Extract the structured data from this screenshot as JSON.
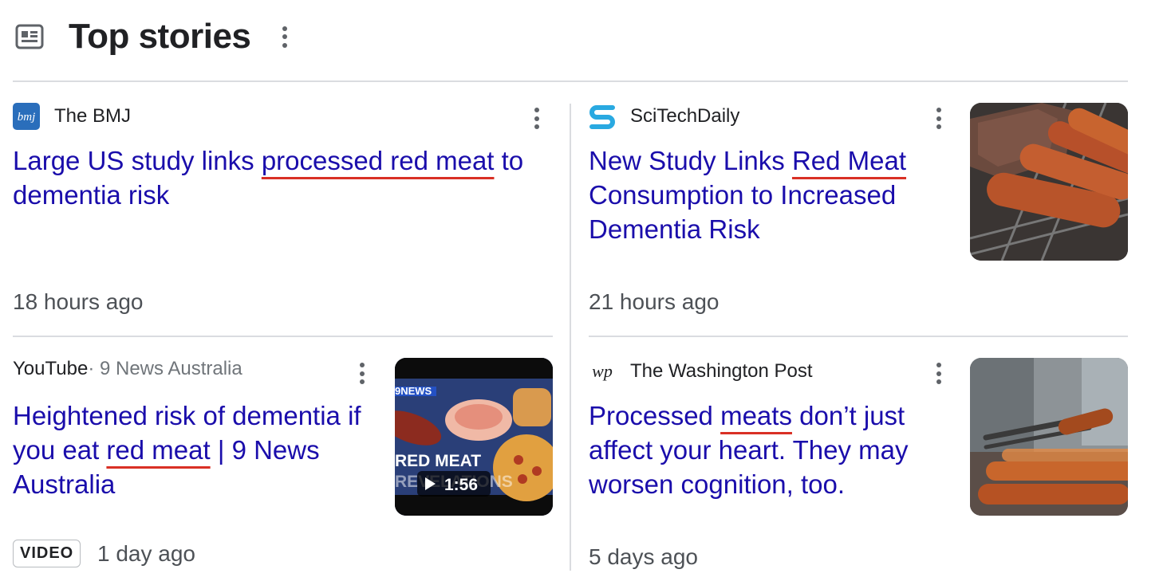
{
  "header": {
    "title": "Top stories",
    "icon": "newspaper-icon"
  },
  "stories": [
    {
      "source": "The BMJ",
      "favicon_text": "bmj",
      "headline_pre": "Large US study links ",
      "headline_hl": "processed red meat",
      "headline_post": " to dementia risk",
      "time": "18 hours ago"
    },
    {
      "source": "SciTechDaily",
      "headline_pre": "New Study Links ",
      "headline_hl": "Red Meat",
      "headline_post": " Consumption to Increased Dementia Risk",
      "time": "21 hours ago"
    },
    {
      "source": "YouTube",
      "source_sub": " · 9 News Australia",
      "headline_pre": "Heightened risk of dementia if you eat ",
      "headline_hl": "red meat",
      "headline_post": " | 9 News Australia",
      "badge": "VIDEO",
      "time": "1 day ago",
      "video": {
        "channel": "9NEWS",
        "overlay_line1": "RED MEAT",
        "overlay_line2": "REVELATIONS",
        "duration": "1:56"
      }
    },
    {
      "source": "The Washington Post",
      "favicon_text": "wp",
      "headline_pre": "Processed ",
      "headline_hl": "meats",
      "headline_post": " don’t just affect your heart. They may worsen cognition, too.",
      "time": "5 days ago"
    }
  ],
  "colors": {
    "link": "#1a0dab",
    "highlight_underline": "#d93025",
    "divider": "#dadce0"
  }
}
